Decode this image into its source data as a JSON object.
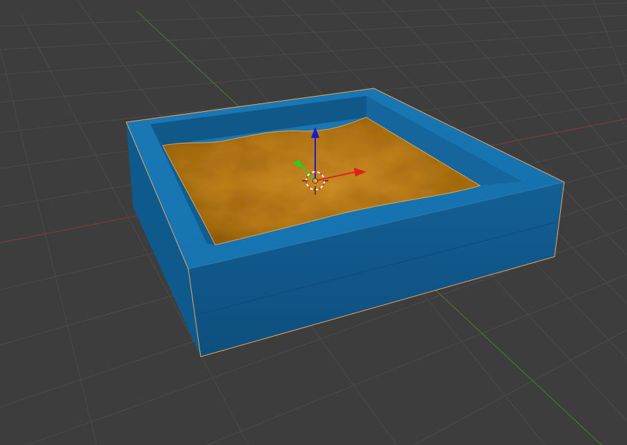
{
  "viewport": {
    "kind": "3D viewport",
    "background_color": "#3d3d3d",
    "grid_color": "#4b4b4b",
    "x_axis_color": "#8f3a3a",
    "y_axis_color": "#4a7f32",
    "selection_outline_color": "#f2a85c"
  },
  "scene": {
    "objects": [
      {
        "name": "sandbox-frame",
        "color": "#1572ad",
        "dark_color": "#0f5a8d",
        "selected": true
      },
      {
        "name": "sand",
        "color": "#c8891d",
        "dark_color": "#8a5508",
        "selected": true
      }
    ],
    "gizmo": {
      "x_color": "#e0211d",
      "y_color": "#20d61b",
      "z_color": "#1a1ad5",
      "cursor_icon": "3d-cursor-icon"
    }
  }
}
